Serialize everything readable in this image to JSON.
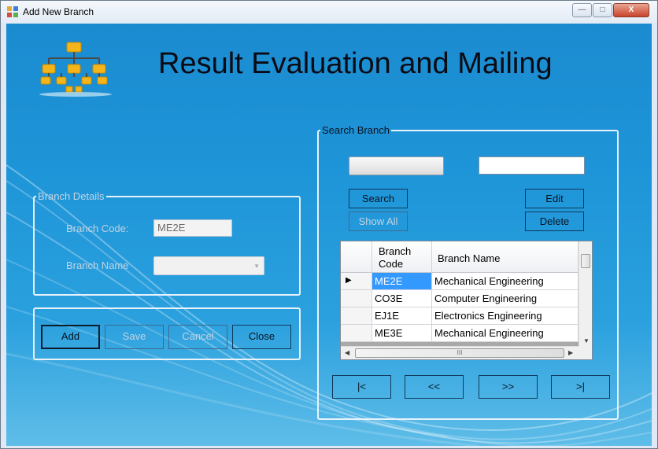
{
  "window": {
    "title": "Add New Branch",
    "minimize": "—",
    "maximize": "□",
    "close": "X"
  },
  "heading": "Result Evaluation and Mailing",
  "branch_details": {
    "legend": "Branch Details",
    "code_label": "Branch Code:",
    "code_value": "ME2E",
    "name_label": "Branch Name",
    "name_value": ""
  },
  "actions": {
    "add": "Add",
    "save": "Save",
    "cancel": "Cancel",
    "close": "Close"
  },
  "search": {
    "legend": "Search Branch",
    "field_value": "",
    "text_value": "",
    "search_button": "Search",
    "edit_button": "Edit",
    "show_all_button": "Show All",
    "delete_button": "Delete"
  },
  "grid": {
    "columns": [
      "Branch Code",
      "Branch Name"
    ],
    "rows": [
      {
        "code": "ME2E",
        "name": "Mechanical Engineering"
      },
      {
        "code": "CO3E",
        "name": "Computer Engineering"
      },
      {
        "code": "EJ1E",
        "name": "Electronics Engineering"
      },
      {
        "code": "ME3E",
        "name": "Mechanical Engineering"
      }
    ],
    "current_row_marker": "▶",
    "hscroll_grip": "III"
  },
  "navigation": {
    "first": "|<",
    "prev": "<<",
    "next": ">>",
    "last": ">|"
  },
  "colors": {
    "accent": "#1e95d8",
    "selected_cell": "#3399ff"
  }
}
